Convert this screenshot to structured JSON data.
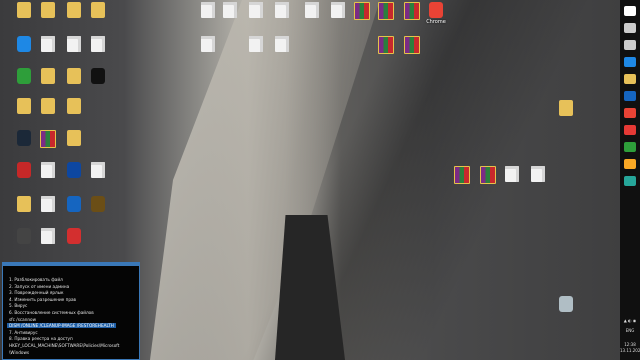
{
  "desktop": {
    "wallpaper": "granite-cliff-with-climbers",
    "icons": [
      {
        "label": "",
        "type": "fold"
      },
      {
        "label": "",
        "type": "fold"
      },
      {
        "label": "",
        "type": "fold"
      },
      {
        "label": "",
        "type": "fold"
      },
      {
        "label": "",
        "type": "doc"
      },
      {
        "label": "",
        "type": "doc"
      },
      {
        "label": "",
        "type": "doc"
      },
      {
        "label": "",
        "type": "doc"
      },
      {
        "label": "",
        "type": "doc"
      },
      {
        "label": "",
        "type": "doc"
      },
      {
        "label": "",
        "type": "rar"
      },
      {
        "label": "",
        "type": "rar"
      },
      {
        "label": "",
        "type": "rar"
      },
      {
        "label": "Chrome",
        "type": "app",
        "color": "#e94335"
      },
      {
        "label": "",
        "type": "app",
        "color": "#1e88e5"
      },
      {
        "label": "",
        "type": "doc"
      },
      {
        "label": "",
        "type": "doc"
      },
      {
        "label": "",
        "type": "doc"
      },
      {
        "label": "",
        "type": "doc"
      },
      {
        "label": "",
        "type": "doc"
      },
      {
        "label": "",
        "type": "doc"
      },
      {
        "label": "",
        "type": "rar"
      },
      {
        "label": "",
        "type": "rar"
      },
      {
        "label": "",
        "type": "app",
        "color": "#2e9e3a"
      },
      {
        "label": "",
        "type": "fold"
      },
      {
        "label": "",
        "type": "fold"
      },
      {
        "label": "",
        "type": "app",
        "color": "#111111"
      },
      {
        "label": "",
        "type": "fold"
      },
      {
        "label": "",
        "type": "fold"
      },
      {
        "label": "",
        "type": "fold"
      },
      {
        "label": "",
        "type": "app",
        "color": "#1b2838"
      },
      {
        "label": "",
        "type": "rar"
      },
      {
        "label": "",
        "type": "fold"
      },
      {
        "label": "",
        "type": "app",
        "color": "#c62828"
      },
      {
        "label": "",
        "type": "doc"
      },
      {
        "label": "",
        "type": "app",
        "color": "#0d47a1"
      },
      {
        "label": "",
        "type": "doc"
      },
      {
        "label": "",
        "type": "fold"
      },
      {
        "label": "",
        "type": "doc"
      },
      {
        "label": "",
        "type": "app",
        "color": "#1565c0"
      },
      {
        "label": "",
        "type": "app",
        "color": "#6b4e16"
      },
      {
        "label": "",
        "type": "app",
        "color": "#444"
      },
      {
        "label": "",
        "type": "doc"
      },
      {
        "label": "",
        "type": "app",
        "color": "#d32f2f"
      },
      {
        "label": "",
        "type": "rar"
      },
      {
        "label": "",
        "type": "rar"
      },
      {
        "label": "",
        "type": "doc"
      },
      {
        "label": "",
        "type": "doc"
      },
      {
        "label": "",
        "type": "fold"
      },
      {
        "label": "",
        "type": "app",
        "color": "#b0bec5"
      }
    ]
  },
  "notes": {
    "lines": [
      "1. Разблокировать файл",
      "2. Запуск от имени админа",
      "3. Поврежденный ярлык",
      "4. Изменить разрешение прав",
      "5. Вирус",
      "6. Восстановление системных файлов",
      "sfc /scannow",
      "DISM /ONLINE /CLEANUP-IMAGE /RESTOREHEALTH",
      "7. Антивирус",
      "8. Правка реестра на доступ",
      "HKEY_LOCAL_MACHINE\\SOFTWARE\\Policies\\Microsoft",
      "\\Windows"
    ],
    "selected_index": 7
  },
  "taskbar": {
    "items": [
      {
        "icon": "start-icon",
        "color": "#ffffff"
      },
      {
        "icon": "search-icon",
        "color": "#cccccc"
      },
      {
        "icon": "task-view-icon",
        "color": "#cccccc"
      },
      {
        "icon": "edge-icon",
        "color": "#1e88e5"
      },
      {
        "icon": "explorer-icon",
        "color": "#e7c159"
      },
      {
        "icon": "store-icon",
        "color": "#1565c0"
      },
      {
        "icon": "chrome-icon",
        "color": "#e94335"
      },
      {
        "icon": "yandex-icon",
        "color": "#e53935"
      },
      {
        "icon": "camtasia-icon",
        "color": "#2e9e3a"
      },
      {
        "icon": "app-icon",
        "color": "#f9a825"
      },
      {
        "icon": "app-icon",
        "color": "#26a69a"
      }
    ],
    "lang": "ENG",
    "time": "12:38",
    "date": "13.11.2020"
  }
}
